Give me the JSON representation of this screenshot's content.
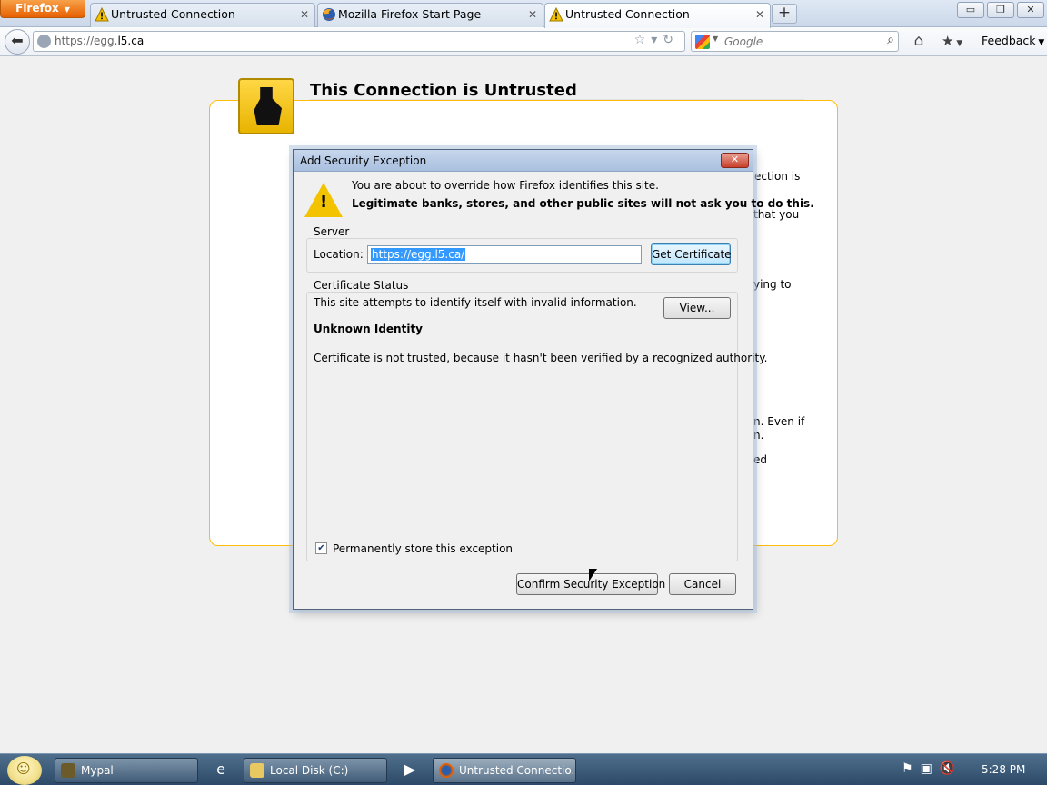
{
  "browser": {
    "menu_button": "Firefox",
    "tabs": [
      {
        "title": "Untrusted Connection",
        "icon": "warning-icon",
        "active": false
      },
      {
        "title": "Mozilla Firefox Start Page",
        "icon": "firefox-icon",
        "active": false
      },
      {
        "title": "Untrusted Connection",
        "icon": "warning-icon",
        "active": true
      }
    ],
    "new_tab_label": "+",
    "window_controls": {
      "minimize": "▭",
      "restore": "❐",
      "close": "✕"
    }
  },
  "navbar": {
    "url_prefix": "https://egg.",
    "url_host": "l5.ca",
    "search_placeholder": "Google",
    "feedback_label": "Feedback"
  },
  "error_page": {
    "title": "This Connection is Untrusted",
    "fragments": [
      "ection is",
      "that you",
      "ying to",
      "n. Even if",
      "n.",
      "ed"
    ]
  },
  "dialog": {
    "title": "Add Security Exception",
    "message_line1": "You are about to override how Firefox identifies this site.",
    "message_line2": "Legitimate banks, stores, and other public sites will not ask you to do this.",
    "server_group_label": "Server",
    "location_label": "Location:",
    "location_value": "https://egg.l5.ca/",
    "get_certificate_button": "Get Certificate",
    "status_group_label": "Certificate Status",
    "status_text": "This site attempts to identify itself with invalid information.",
    "view_button": "View...",
    "identity_heading": "Unknown Identity",
    "certificate_reason": "Certificate is not trusted, because it hasn't been verified by a recognized authority.",
    "permanent_store_label": "Permanently store this exception",
    "permanent_store_checked": true,
    "confirm_button": "Confirm Security Exception",
    "cancel_button": "Cancel"
  },
  "taskbar": {
    "tasks": [
      {
        "label": "Mypal",
        "icon": "mypal-icon",
        "active": false
      },
      {
        "label": "Local Disk (C:)",
        "icon": "folder-icon",
        "active": false
      },
      {
        "label": "Untrusted Connectio...",
        "icon": "firefox-icon",
        "active": true
      }
    ],
    "clock": "5:28 PM"
  },
  "colors": {
    "accent_orange": "#e66000",
    "error_border": "#ffbd09",
    "selection_blue": "#3399ff"
  }
}
